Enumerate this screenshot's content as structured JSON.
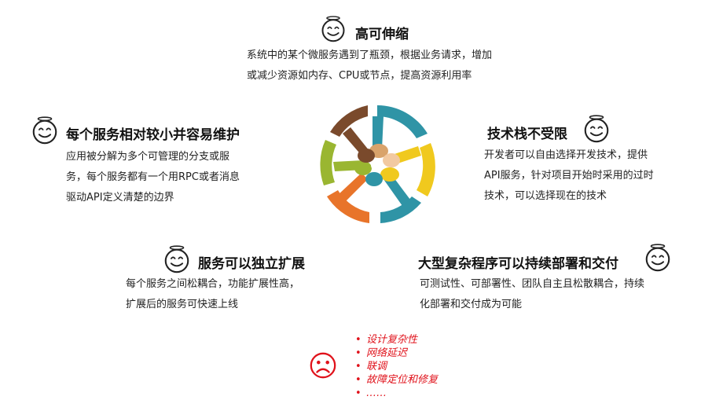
{
  "center_graphic": {
    "name": "joined-hands-circle",
    "colors": [
      "#2f94a6",
      "#f0c91e",
      "#9ab631",
      "#e8742a",
      "#7a4a2c",
      "#d9a36b",
      "#f2c9a1"
    ]
  },
  "benefits": [
    {
      "id": "scalable",
      "title": "高可伸缩",
      "lines": [
        "系统中的某个微服务遇到了瓶颈，根据业务请求，增加",
        "或减少资源如内存、CPU或节点，提高资源利用率"
      ],
      "icon": "smiley-icon"
    },
    {
      "id": "small-service",
      "title": "每个服务相对较小并容易维护",
      "lines": [
        "应用被分解为多个可管理的分支或服",
        "务，每个服务都有一个用RPC或者消息",
        "驱动API定义清楚的边界"
      ],
      "icon": "smiley-icon"
    },
    {
      "id": "tech-stack",
      "title": "技术栈不受限",
      "lines": [
        "开发者可以自由选择开发技术，提供",
        "API服务，针对项目开始时采用的过时",
        "技术，可以选择现在的技术"
      ],
      "icon": "smiley-icon"
    },
    {
      "id": "independent-scale",
      "title": "服务可以独立扩展",
      "lines": [
        "每个服务之间松耦合，功能扩展性高，",
        "扩展后的服务可快速上线"
      ],
      "icon": "smiley-icon"
    },
    {
      "id": "continuous-delivery",
      "title": "大型复杂程序可以持续部署和交付",
      "lines": [
        "可测试性、可部署性、团队自主且松散耦合，持续",
        "化部署和交付成为可能"
      ],
      "icon": "smiley-icon"
    }
  ],
  "drawbacks": {
    "icon": "sad-face-icon",
    "items": [
      "设计复杂性",
      "网络延迟",
      "联调",
      "故障定位和修复",
      "……"
    ],
    "bullet": "•",
    "color": "#e0121b"
  }
}
